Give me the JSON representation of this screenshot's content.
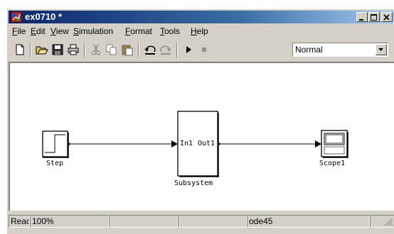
{
  "window": {
    "title": "ex0710 *"
  },
  "menubar": {
    "items": [
      "File",
      "Edit",
      "View",
      "Simulation",
      "Format",
      "Tools",
      "Help"
    ]
  },
  "toolbar": {
    "icons": [
      "new-model-icon",
      "open-icon",
      "save-icon",
      "print-icon",
      "cut-icon",
      "copy-icon",
      "paste-icon",
      "undo-icon",
      "redo-icon",
      "start-simulation-icon",
      "stop-simulation-icon"
    ],
    "mode": "Normal"
  },
  "model": {
    "blocks": {
      "step": {
        "label": "Step"
      },
      "subsystem": {
        "label": "Subsystem",
        "in_port": "In1",
        "out_port": "Out1"
      },
      "scope": {
        "label": "Scope1"
      }
    }
  },
  "statusbar": {
    "state": "Reac",
    "zoom": "100%",
    "field3": "",
    "field4": "",
    "solver": "ode45"
  },
  "colors": {
    "title_start": "#0a246a",
    "title_end": "#a6caf0",
    "chrome": "#d4d0c8"
  }
}
